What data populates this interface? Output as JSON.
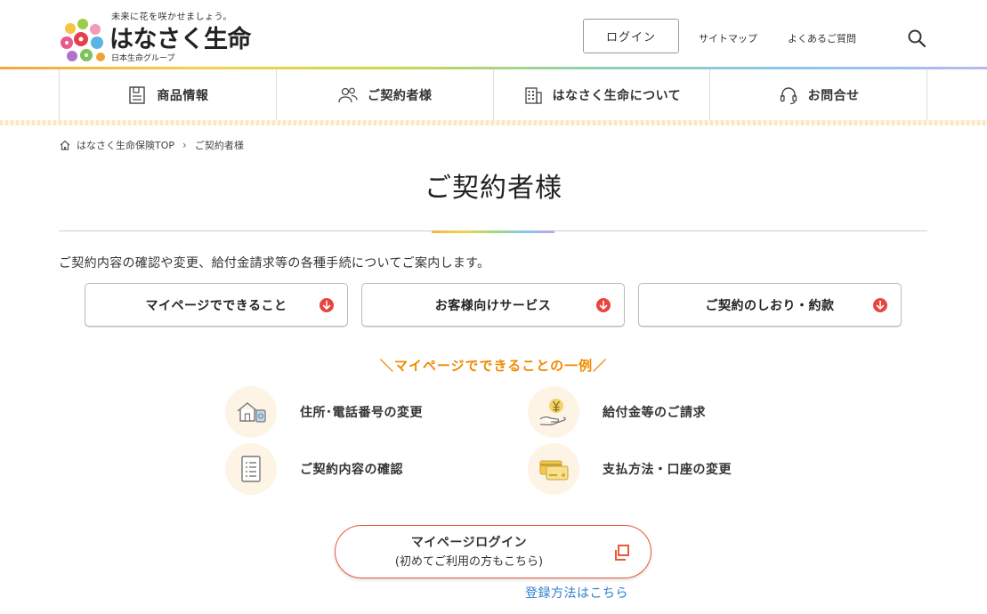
{
  "header": {
    "tagline": "未来に花を咲かせましょう。",
    "brand_name": "はなさく生命",
    "group_name": "日本生命グループ",
    "login_label": "ログイン",
    "sitemap_label": "サイトマップ",
    "faq_label": "よくあるご質問",
    "search_icon": "search-icon"
  },
  "nav": {
    "items": [
      {
        "label": "商品情報",
        "icon": "product-info-icon"
      },
      {
        "label": "ご契約者様",
        "icon": "people-icon"
      },
      {
        "label": "はなさく生命について",
        "icon": "building-icon"
      },
      {
        "label": "お問合せ",
        "icon": "headset-icon"
      }
    ]
  },
  "breadcrumb": {
    "home": "はなさく生命保険TOP",
    "current": "ご契約者様",
    "separator": "＞"
  },
  "page": {
    "title": "ご契約者様",
    "intro": "ご契約内容の確認や変更、給付金請求等の各種手続についてご案内します。"
  },
  "anchors": [
    {
      "label": "マイページでできること"
    },
    {
      "label": "お客様向けサービス"
    },
    {
      "label": "ご契約のしおり・約款"
    }
  ],
  "examples": {
    "heading": "＼マイページでできることの一例／",
    "items": [
      {
        "label": "住所･電話番号の変更",
        "icon": "house-phone-icon"
      },
      {
        "label": "給付金等のご請求",
        "icon": "yen-hand-icon"
      },
      {
        "label": "ご契約内容の確認",
        "icon": "document-list-icon"
      },
      {
        "label": "支払方法・口座の変更",
        "icon": "cards-icon"
      }
    ]
  },
  "mypage": {
    "line1": "マイページログイン",
    "line2": "(初めてご利用の方もこちら)",
    "register_link": "登録方法はこちら"
  },
  "colors": {
    "accent_orange": "#f08a00",
    "arrow_red": "#e8453c",
    "link_blue": "#2f7fd1",
    "icon_bg": "#fdf4e6"
  }
}
